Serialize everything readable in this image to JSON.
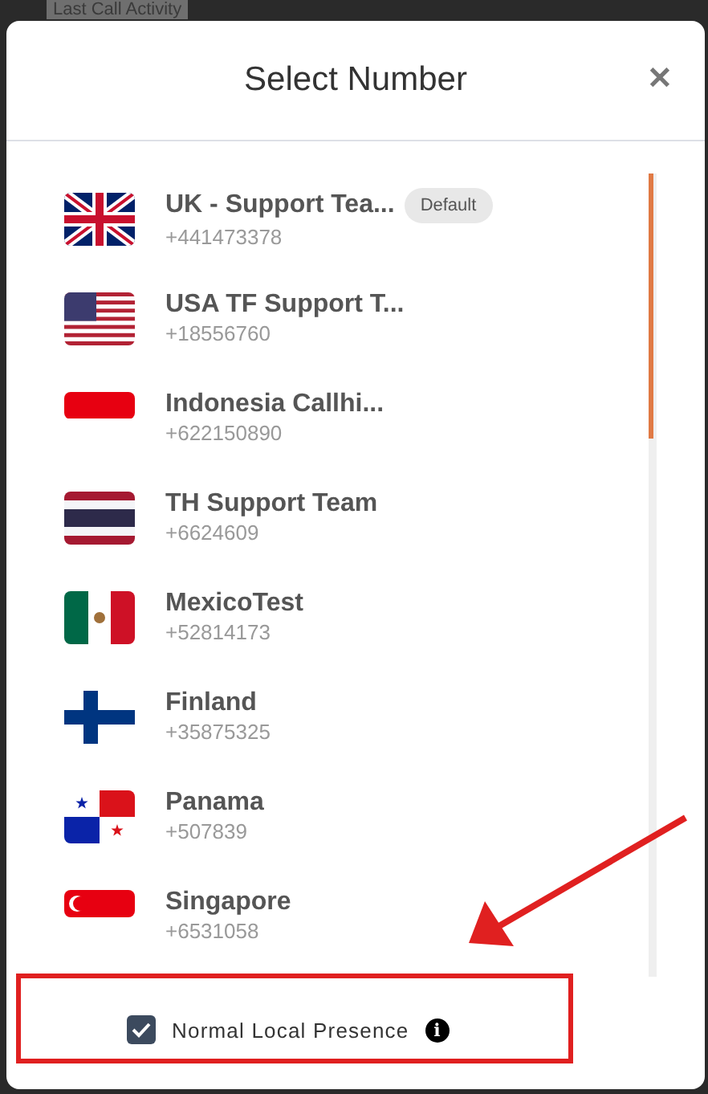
{
  "background": {
    "title": "Last Call Activity"
  },
  "dialog": {
    "title": "Select Number",
    "close": "✕"
  },
  "numbers": [
    {
      "kind": "uk",
      "name": "UK - Support Tea...",
      "number": "+441473378",
      "badge": "Default"
    },
    {
      "kind": "us",
      "name": "USA TF Support T...",
      "number": "+18556760"
    },
    {
      "kind": "id",
      "name": "Indonesia Callhi...",
      "number": "+622150890"
    },
    {
      "kind": "th",
      "name": "TH Support Team",
      "number": "+6624609"
    },
    {
      "kind": "mx",
      "name": "MexicoTest",
      "number": "+52814173"
    },
    {
      "kind": "fi",
      "name": "Finland",
      "number": "+35875325"
    },
    {
      "kind": "pa",
      "name": "Panama",
      "number": "+507839"
    },
    {
      "kind": "sg",
      "name": "Singapore",
      "number": "+6531058"
    }
  ],
  "footer": {
    "label": "Normal Local Presence",
    "checked": true,
    "info": "i"
  }
}
